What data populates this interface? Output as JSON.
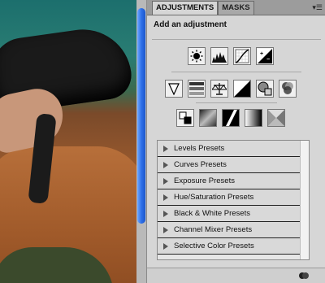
{
  "panel": {
    "tabs": [
      "ADJUSTMENTS",
      "MASKS"
    ],
    "menu_icon": "panel-menu-icon",
    "title": "Add an adjustment"
  },
  "icons": {
    "row1": [
      "brightness-contrast-icon",
      "levels-icon",
      "curves-icon",
      "exposure-icon"
    ],
    "row2": [
      "vibrance-icon",
      "hue-saturation-icon",
      "color-balance-icon",
      "black-white-icon",
      "photo-filter-icon",
      "channel-mixer-icon"
    ],
    "row3": [
      "invert-icon",
      "posterize-icon",
      "threshold-icon",
      "gradient-map-icon",
      "selective-color-icon"
    ]
  },
  "presets": [
    "Levels Presets",
    "Curves Presets",
    "Exposure Presets",
    "Hue/Saturation Presets",
    "Black & White Presets",
    "Channel Mixer Presets",
    "Selective Color Presets"
  ]
}
